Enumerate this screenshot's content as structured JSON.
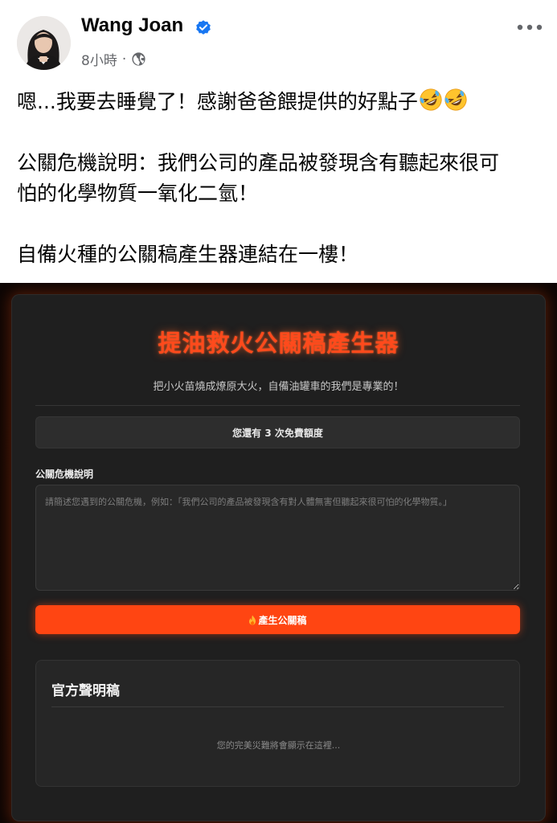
{
  "post": {
    "author": "Wang Joan",
    "time": "8小時",
    "separator": "·",
    "lines": [
      "嗯...我要去睡覺了！感謝爸爸餵提供的好點子",
      "公關危機說明：我們公司的產品被發現含有聽起來很可",
      "怕的化學物質一氧化二氫！",
      "自備火種的公關稿產生器連結在一樓！"
    ],
    "emoji": "rolling-on-floor-laughing-emoji"
  },
  "icons": {
    "verified": "verified-badge-icon",
    "globe": "globe-icon",
    "more": "more-options-icon",
    "fire": "fire-icon"
  },
  "colors": {
    "verified_blue": "#1877f2",
    "title_orange": "#ff4a1c",
    "button_orange": "#ff4512",
    "app_background": "#1f1f1f"
  },
  "app": {
    "title": "提油救火公關稿產生器",
    "subtitle": "把小火苗燒成燎原大火，自備油罐車的我們是專業的！",
    "quota_text": "您還有 3 次免費額度",
    "field_label": "公關危機說明",
    "input_placeholder": "請簡述您遇到的公關危機，例如：「我們公司的產品被發現含有對人體無害但聽起來很可怕的化學物質。」",
    "input_value": "",
    "button_label": "產生公關稿",
    "result_title": "官方聲明稿",
    "result_placeholder": "您的完美災難將會顯示在這裡..."
  }
}
